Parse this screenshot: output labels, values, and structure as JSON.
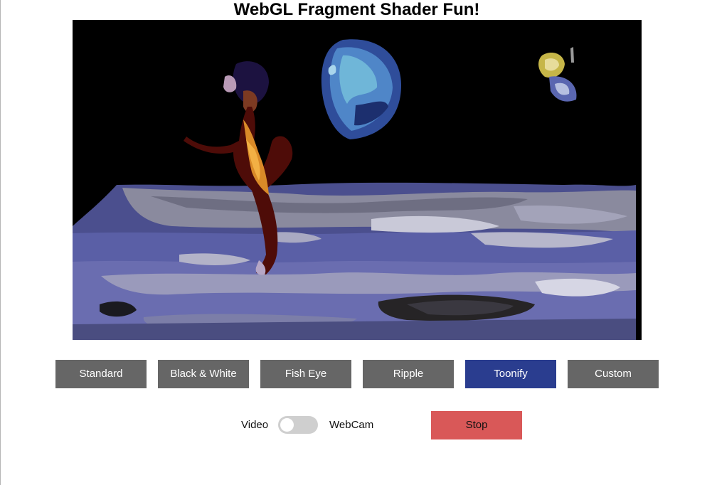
{
  "page": {
    "title": "WebGL Fragment Shader Fun!"
  },
  "video": {
    "description_icon": "toonified-video-frame",
    "active_filter": "Toonify"
  },
  "filters": [
    {
      "label": "Standard",
      "active": false
    },
    {
      "label": "Black & White",
      "active": false
    },
    {
      "label": "Fish Eye",
      "active": false
    },
    {
      "label": "Ripple",
      "active": false
    },
    {
      "label": "Toonify",
      "active": true
    },
    {
      "label": "Custom",
      "active": false
    }
  ],
  "source": {
    "left_label": "Video",
    "right_label": "WebCam",
    "toggle_on": false
  },
  "playback": {
    "stop_label": "Stop"
  },
  "colors": {
    "button_gray": "#666666",
    "button_active": "#2a3d8f",
    "stop_red": "#d95858",
    "toggle_track": "#cfcfcf"
  }
}
